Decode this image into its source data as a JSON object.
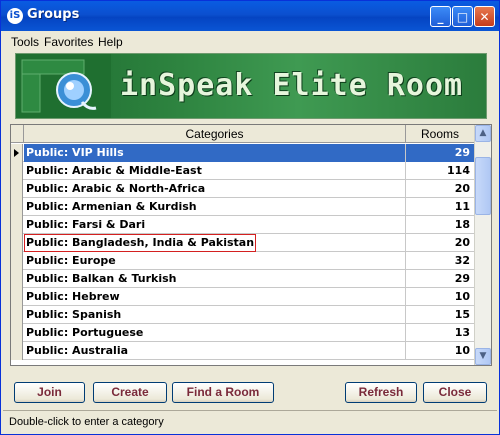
{
  "window": {
    "title": "Groups",
    "app_icon": "inspeak-icon"
  },
  "title_buttons": {
    "minimize": "_",
    "maximize": "□",
    "close": "✕"
  },
  "menubar": {
    "items": [
      "Tools",
      "Favorites",
      "Help"
    ]
  },
  "banner": {
    "text": "inSpeak Elite Room"
  },
  "grid": {
    "columns": [
      "Categories",
      "Rooms"
    ],
    "rows": [
      {
        "category": "Public: VIP Hills",
        "rooms": "29"
      },
      {
        "category": "Public: Arabic & Middle-East",
        "rooms": "114"
      },
      {
        "category": "Public: Arabic & North-Africa",
        "rooms": "20"
      },
      {
        "category": "Public: Armenian & Kurdish",
        "rooms": "11"
      },
      {
        "category": "Public: Farsi & Dari",
        "rooms": "18"
      },
      {
        "category": "Public: Bangladesh, India & Pakistan",
        "rooms": "20"
      },
      {
        "category": "Public: Europe",
        "rooms": "32"
      },
      {
        "category": "Public: Balkan & Turkish",
        "rooms": "29"
      },
      {
        "category": "Public: Hebrew",
        "rooms": "10"
      },
      {
        "category": "Public: Spanish",
        "rooms": "15"
      },
      {
        "category": "Public: Portuguese",
        "rooms": "13"
      },
      {
        "category": "Public: Australia",
        "rooms": "10"
      }
    ],
    "selected_row": "Public: VIP Hills"
  },
  "buttons": {
    "join": "Join",
    "create": "Create",
    "find": "Find a Room",
    "refresh": "Refresh",
    "close": "Close"
  },
  "status": {
    "text": "Double-click to enter a category"
  },
  "colors": {
    "selection": "#316ac5",
    "banner": "#2e8440",
    "titlebar": "#0b4fcf",
    "highlight_border": "#d42020"
  }
}
